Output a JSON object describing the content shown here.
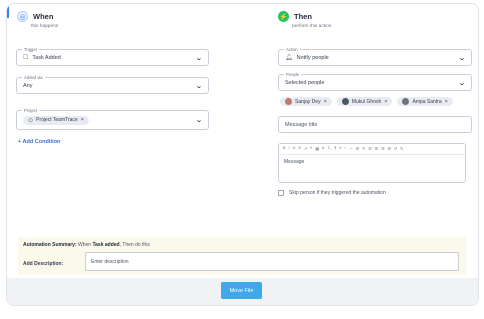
{
  "when": {
    "title": "When",
    "subtitle": "this happens"
  },
  "then": {
    "title": "Then",
    "subtitle": "perform this action"
  },
  "trigger": {
    "legend": "Trigger",
    "value": "Task Added"
  },
  "added_via": {
    "legend": "Added via",
    "value": "Any"
  },
  "project": {
    "legend": "Project",
    "chip": "Project TeamTrace"
  },
  "add_condition": "+ Add Condition",
  "action": {
    "legend": "Action",
    "value": "Notify people"
  },
  "people": {
    "legend": "People",
    "value": "Selected people",
    "chips": [
      {
        "name": "Sanjay Dey",
        "color": "#c0786a"
      },
      {
        "name": "Mukul Ghosh",
        "color": "#4b5563"
      },
      {
        "name": "Ampa Santra",
        "color": "#6b7280"
      }
    ]
  },
  "message_title_placeholder": "Message title",
  "message_placeholder": "Message",
  "toolbar_glyphs": [
    "B",
    "I",
    "U",
    "S",
    "↗",
    "≡",
    "▦",
    "A",
    "T₂",
    "¶",
    "≡",
    "•",
    "—",
    "☰",
    "✎",
    "☰",
    "☰",
    "☰",
    "☰",
    "↺",
    "↻"
  ],
  "skip_label": "Skip person if they triggered the automation",
  "summary": {
    "label": "Automation Summary:",
    "text_pre": "When",
    "event": "Task added",
    "text_post": ", Then do this"
  },
  "description": {
    "label": "Add Description:",
    "placeholder": "Enter description"
  },
  "move_button": "Move File",
  "colors": {
    "accent": "#3b82f6",
    "button": "#3fa8ea",
    "then_icon": "#22c55e",
    "summary_bg": "#fbf8ec"
  }
}
